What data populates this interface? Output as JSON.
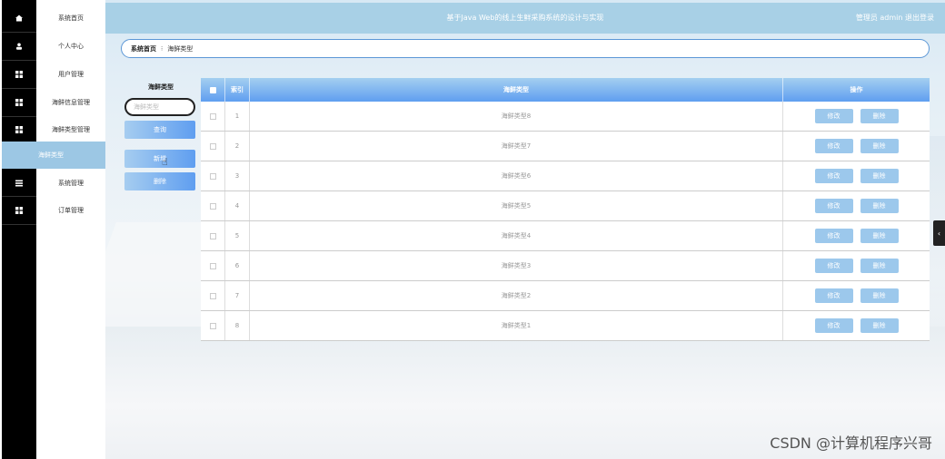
{
  "header": {
    "title": "基于Java Web的线上生鲜采购系统的设计与实现",
    "user": "管理员 admin  退出登录"
  },
  "sidebar": {
    "items": [
      {
        "label": "系统首页",
        "icon": "home-icon"
      },
      {
        "label": "个人中心",
        "icon": "user-icon"
      },
      {
        "label": "用户管理",
        "icon": "grid-icon"
      },
      {
        "label": "海鲜信息管理",
        "icon": "grid-icon"
      },
      {
        "label": "海鲜类型管理",
        "icon": "grid-icon"
      },
      {
        "label": "系统管理",
        "icon": "menu-icon"
      },
      {
        "label": "订单管理",
        "icon": "grid-icon"
      }
    ],
    "active_sub": "海鲜类型"
  },
  "breadcrumb": {
    "home": "系统首页",
    "sep": "⁝",
    "current": "海鲜类型"
  },
  "search": {
    "label": "海鲜类型",
    "placeholder": "海鲜类型",
    "query_label": "查询",
    "add_label": "新增",
    "delete_label": "删除"
  },
  "table": {
    "headers": {
      "index": "索引",
      "type": "海鲜类型",
      "ops": "操作"
    },
    "rows": [
      {
        "index": "1",
        "type": "海鲜类型8"
      },
      {
        "index": "2",
        "type": "海鲜类型7"
      },
      {
        "index": "3",
        "type": "海鲜类型6"
      },
      {
        "index": "4",
        "type": "海鲜类型5"
      },
      {
        "index": "5",
        "type": "海鲜类型4"
      },
      {
        "index": "6",
        "type": "海鲜类型3"
      },
      {
        "index": "7",
        "type": "海鲜类型2"
      },
      {
        "index": "8",
        "type": "海鲜类型1"
      }
    ],
    "edit_label": "修改",
    "delete_label": "删除"
  },
  "watermark": "CSDN @计算机程序兴哥",
  "colors": {
    "accent": "#5f9ef0",
    "topbar": "#a8d0e6",
    "sidebar_icons": "#000000",
    "active_menu": "#9cc7e4"
  }
}
